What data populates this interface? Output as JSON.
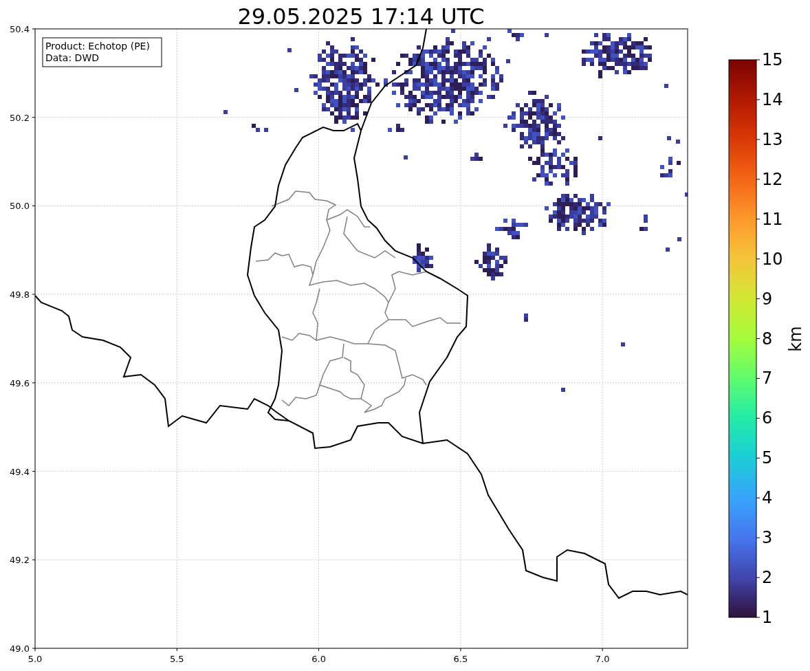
{
  "title": "29.05.2025 17:14 UTC",
  "info": [
    "Product: Echotop (PE)",
    "Data: DWD"
  ],
  "x_axis": {
    "ticks": [
      "5.0",
      "5.5",
      "6.0",
      "6.5",
      "7.0"
    ]
  },
  "y_axis": {
    "ticks": [
      "50.4",
      "50.2",
      "50.0",
      "49.8",
      "49.6",
      "49.4",
      "49.2",
      "49.0"
    ]
  },
  "colorbar": {
    "label": "km",
    "ticks": [
      "15",
      "14",
      "13",
      "12",
      "11",
      "10",
      "9",
      "8",
      "7",
      "6",
      "5",
      "4",
      "3",
      "2",
      "1"
    ]
  }
}
